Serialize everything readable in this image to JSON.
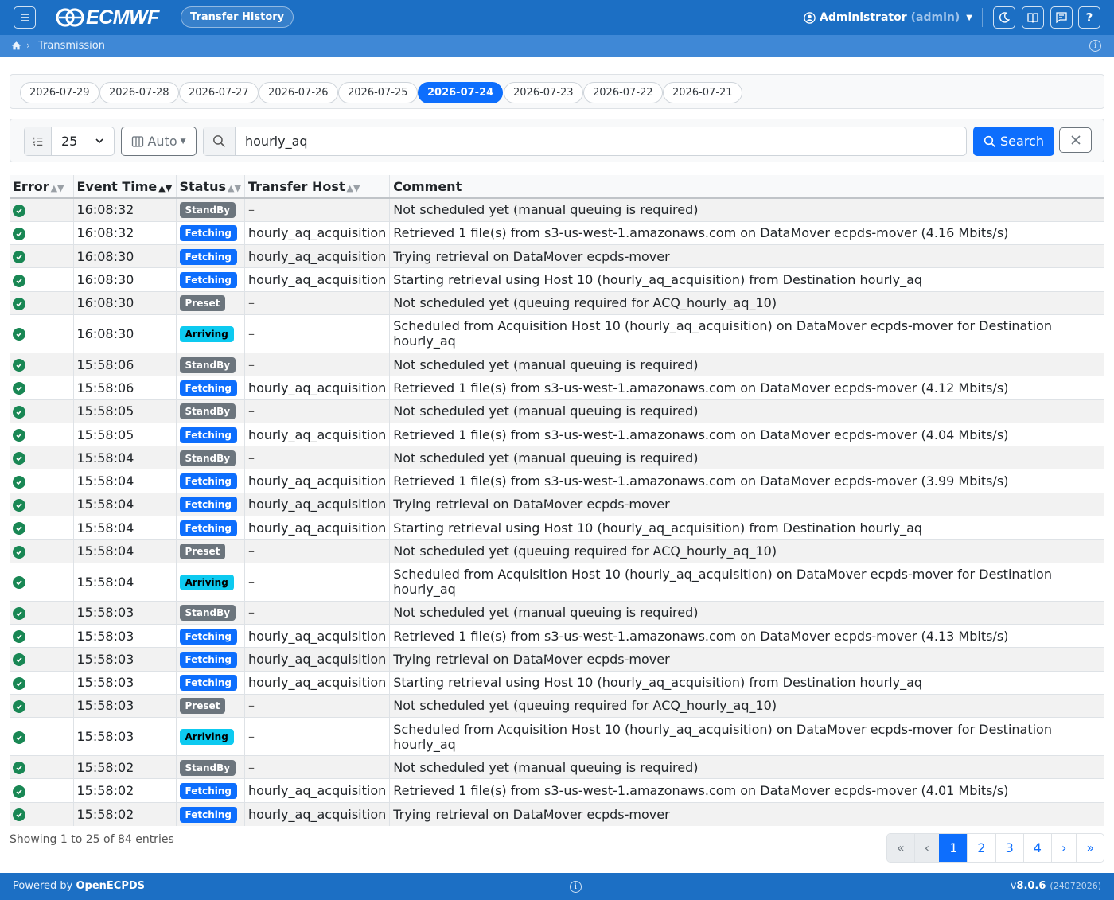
{
  "navbar": {
    "logo_text": "ECMWF",
    "page_label": "Transfer History",
    "user_name": "Administrator",
    "user_id": "(admin)"
  },
  "breadcrumb": {
    "current": "Transmission"
  },
  "dates": [
    "2026-07-29",
    "2026-07-28",
    "2026-07-27",
    "2026-07-26",
    "2026-07-25",
    "2026-07-24",
    "2026-07-23",
    "2026-07-22",
    "2026-07-21"
  ],
  "active_date": "2026-07-24",
  "toolbar": {
    "page_length": "25",
    "columns_label": "Auto",
    "search_value": "hourly_aq",
    "search_label": "Search"
  },
  "table": {
    "headers": [
      "Error",
      "Event Time",
      "Status",
      "Transfer Host",
      "Comment"
    ],
    "rows": [
      {
        "time": "16:08:32",
        "status": "StandBy",
        "host": "–",
        "comment": "Not scheduled yet (manual queuing is required)"
      },
      {
        "time": "16:08:32",
        "status": "Fetching",
        "host": "hourly_aq_acquisition",
        "comment": "Retrieved 1 file(s) from s3-us-west-1.amazonaws.com on DataMover ecpds-mover (4.16 Mbits/s)"
      },
      {
        "time": "16:08:30",
        "status": "Fetching",
        "host": "hourly_aq_acquisition",
        "comment": "Trying retrieval on DataMover ecpds-mover"
      },
      {
        "time": "16:08:30",
        "status": "Fetching",
        "host": "hourly_aq_acquisition",
        "comment": "Starting retrieval using Host 10 (hourly_aq_acquisition) from Destination hourly_aq"
      },
      {
        "time": "16:08:30",
        "status": "Preset",
        "host": "–",
        "comment": "Not scheduled yet (queuing required for ACQ_hourly_aq_10)"
      },
      {
        "time": "16:08:30",
        "status": "Arriving",
        "host": "–",
        "comment": "Scheduled from Acquisition Host 10 (hourly_aq_acquisition) on DataMover ecpds-mover for Destination hourly_aq"
      },
      {
        "time": "15:58:06",
        "status": "StandBy",
        "host": "–",
        "comment": "Not scheduled yet (manual queuing is required)"
      },
      {
        "time": "15:58:06",
        "status": "Fetching",
        "host": "hourly_aq_acquisition",
        "comment": "Retrieved 1 file(s) from s3-us-west-1.amazonaws.com on DataMover ecpds-mover (4.12 Mbits/s)"
      },
      {
        "time": "15:58:05",
        "status": "StandBy",
        "host": "–",
        "comment": "Not scheduled yet (manual queuing is required)"
      },
      {
        "time": "15:58:05",
        "status": "Fetching",
        "host": "hourly_aq_acquisition",
        "comment": "Retrieved 1 file(s) from s3-us-west-1.amazonaws.com on DataMover ecpds-mover (4.04 Mbits/s)"
      },
      {
        "time": "15:58:04",
        "status": "StandBy",
        "host": "–",
        "comment": "Not scheduled yet (manual queuing is required)"
      },
      {
        "time": "15:58:04",
        "status": "Fetching",
        "host": "hourly_aq_acquisition",
        "comment": "Retrieved 1 file(s) from s3-us-west-1.amazonaws.com on DataMover ecpds-mover (3.99 Mbits/s)"
      },
      {
        "time": "15:58:04",
        "status": "Fetching",
        "host": "hourly_aq_acquisition",
        "comment": "Trying retrieval on DataMover ecpds-mover"
      },
      {
        "time": "15:58:04",
        "status": "Fetching",
        "host": "hourly_aq_acquisition",
        "comment": "Starting retrieval using Host 10 (hourly_aq_acquisition) from Destination hourly_aq"
      },
      {
        "time": "15:58:04",
        "status": "Preset",
        "host": "–",
        "comment": "Not scheduled yet (queuing required for ACQ_hourly_aq_10)"
      },
      {
        "time": "15:58:04",
        "status": "Arriving",
        "host": "–",
        "comment": "Scheduled from Acquisition Host 10 (hourly_aq_acquisition) on DataMover ecpds-mover for Destination hourly_aq"
      },
      {
        "time": "15:58:03",
        "status": "StandBy",
        "host": "–",
        "comment": "Not scheduled yet (manual queuing is required)"
      },
      {
        "time": "15:58:03",
        "status": "Fetching",
        "host": "hourly_aq_acquisition",
        "comment": "Retrieved 1 file(s) from s3-us-west-1.amazonaws.com on DataMover ecpds-mover (4.13 Mbits/s)"
      },
      {
        "time": "15:58:03",
        "status": "Fetching",
        "host": "hourly_aq_acquisition",
        "comment": "Trying retrieval on DataMover ecpds-mover"
      },
      {
        "time": "15:58:03",
        "status": "Fetching",
        "host": "hourly_aq_acquisition",
        "comment": "Starting retrieval using Host 10 (hourly_aq_acquisition) from Destination hourly_aq"
      },
      {
        "time": "15:58:03",
        "status": "Preset",
        "host": "–",
        "comment": "Not scheduled yet (queuing required for ACQ_hourly_aq_10)"
      },
      {
        "time": "15:58:03",
        "status": "Arriving",
        "host": "–",
        "comment": "Scheduled from Acquisition Host 10 (hourly_aq_acquisition) on DataMover ecpds-mover for Destination hourly_aq"
      },
      {
        "time": "15:58:02",
        "status": "StandBy",
        "host": "–",
        "comment": "Not scheduled yet (manual queuing is required)"
      },
      {
        "time": "15:58:02",
        "status": "Fetching",
        "host": "hourly_aq_acquisition",
        "comment": "Retrieved 1 file(s) from s3-us-west-1.amazonaws.com on DataMover ecpds-mover (4.01 Mbits/s)"
      },
      {
        "time": "15:58:02",
        "status": "Fetching",
        "host": "hourly_aq_acquisition",
        "comment": "Trying retrieval on DataMover ecpds-mover"
      }
    ]
  },
  "info_text": "Showing 1 to 25 of 84 entries",
  "pagination": {
    "first": "«",
    "prev": "‹",
    "pages": [
      "1",
      "2",
      "3",
      "4"
    ],
    "current": "1",
    "next": "›",
    "last": "»"
  },
  "footer": {
    "powered_prefix": "Powered by",
    "powered_name": "OpenECPDS",
    "version_prefix": "v",
    "version": "8.0.6",
    "build": "(24072026)"
  },
  "colors": {
    "navbar": "#1c6fc4",
    "breadcrumb": "#3f88d6",
    "primary": "#0d6efd",
    "success": "#198754",
    "arriving": "#0dcaf0",
    "secondary": "#6c757d"
  }
}
